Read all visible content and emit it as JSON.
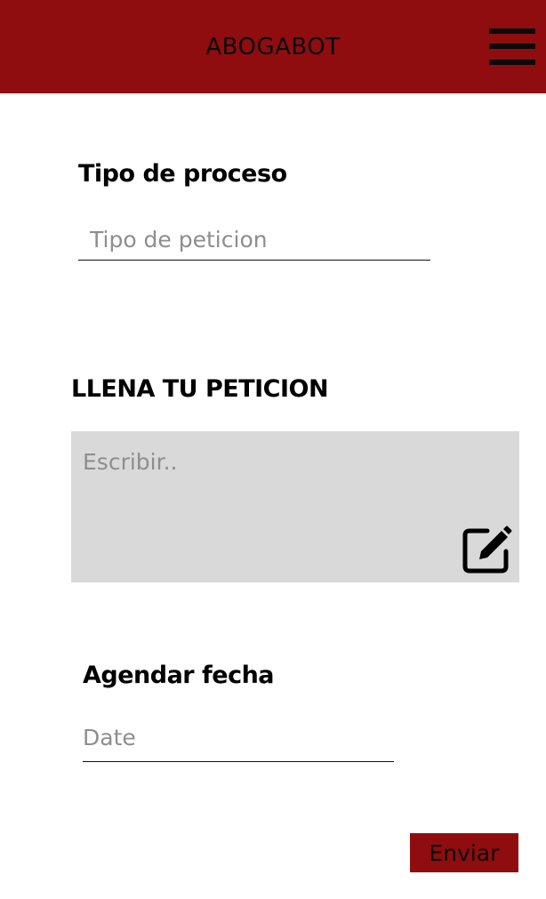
{
  "header": {
    "title": "ABOGABOT",
    "menu_icon": "hamburger-menu-icon",
    "background_color": "#8f0d0e"
  },
  "form": {
    "proceso": {
      "label": "Tipo de proceso",
      "placeholder": "Tipo de peticion",
      "value": ""
    },
    "peticion": {
      "label": "LLENA TU PETICION",
      "placeholder": "Escribir..",
      "value": "",
      "icon": "edit-icon"
    },
    "fecha": {
      "label": "Agendar fecha",
      "placeholder": "Date",
      "value": ""
    },
    "submit_label": "Enviar"
  },
  "colors": {
    "accent": "#8f0d0e",
    "textarea_background": "#d9d9d9",
    "placeholder": "#8e8e8e"
  }
}
